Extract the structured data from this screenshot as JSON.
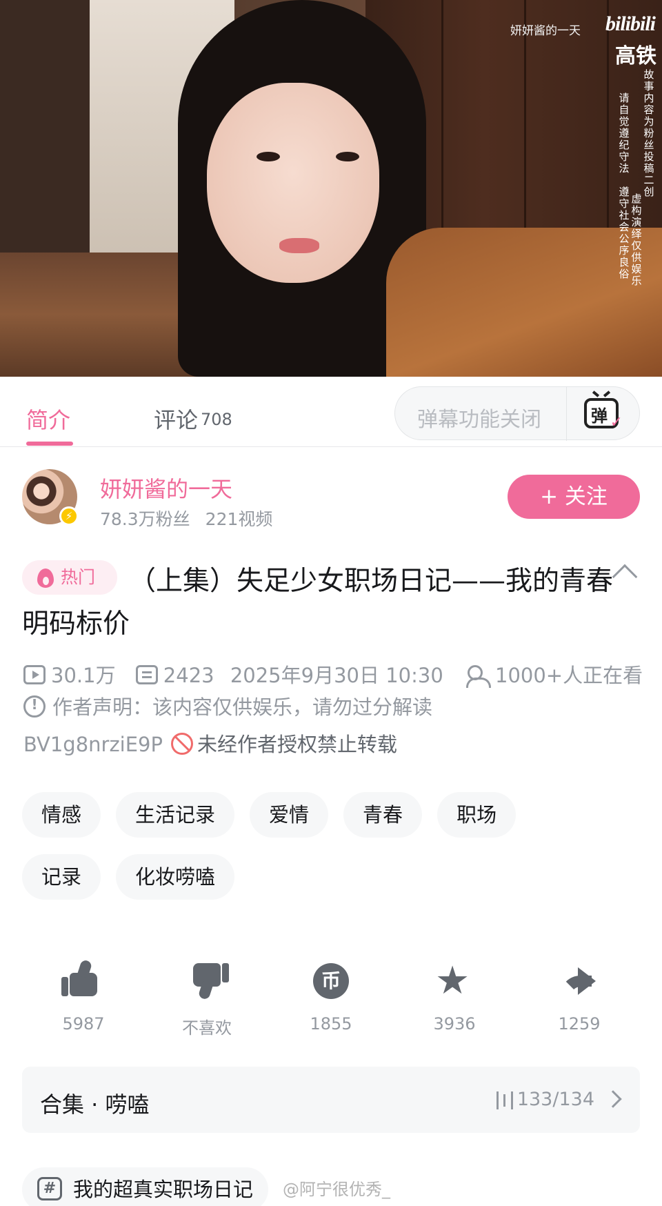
{
  "video": {
    "watermark_channel": "妍妍酱的一天",
    "watermark_logo": "bilibili",
    "watermark_tag": "高铁",
    "note_col1": "故事内容为粉丝投稿二创",
    "note_col2": "虚构演绎仅供娱乐",
    "note_col3": "请自觉遵纪守法",
    "note_col4": "遵守社会公序良俗"
  },
  "tabs": {
    "intro_label": "简介",
    "comments_label": "评论",
    "comments_count": "708",
    "danmaku_placeholder": "弹幕功能关闭",
    "danmaku_icon_char": "弹"
  },
  "author": {
    "name": "妍妍酱的一天",
    "fans": "78.3万粉丝",
    "videos": "221视频",
    "follow_label": "+ 关注"
  },
  "video_info": {
    "hot_label": "热门",
    "title": "（上集）失足少女职场日记——我的青春明码标价",
    "views": "30.1万",
    "danmaku_count": "2423",
    "date": "2025年9月30日 10:30",
    "watching": "1000+人正在看",
    "notice": "作者声明：该内容仅供娱乐，请勿过分解读",
    "bvid": "BV1g8nrziE9P",
    "no_repost": "未经作者授权禁止转载"
  },
  "tags": [
    "情感",
    "生活记录",
    "爱情",
    "青春",
    "职场",
    "记录",
    "化妆唠嗑"
  ],
  "actions": {
    "like_count": "5987",
    "dislike_label": "不喜欢",
    "coin_count": "1855",
    "coin_icon_char": "币",
    "favorite_count": "3936",
    "share_count": "1259"
  },
  "collection": {
    "name": "合集 · 唠嗑",
    "progress": "133/134"
  },
  "series_chip": {
    "label": "我的超真实职场日记",
    "icon_char": "#"
  },
  "overlay_watermark": "@阿宁很优秀_"
}
